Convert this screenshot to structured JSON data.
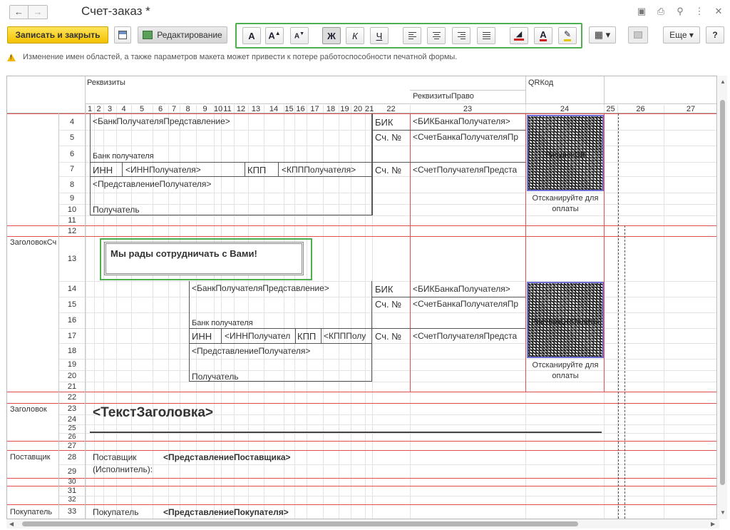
{
  "window": {
    "title": "Счет-заказ *"
  },
  "toolbar": {
    "save_close": "Записать и закрыть",
    "edit": "Редактирование",
    "more": "Еще ▾",
    "help": "?",
    "bold": "Ж",
    "italic": "К",
    "underline": "Ч"
  },
  "warning": {
    "text": "Изменение имен областей, а также параметров макета может привести к потере работоспособности печатной формы."
  },
  "sheet": {
    "col_headers": {
      "rekvizity": "Реквизиты",
      "rekvizity_pravo": "РеквизитыПраво",
      "qrkod": "QRКод"
    },
    "col_numbers": [
      "1",
      "2",
      "3",
      "4",
      "5",
      "6",
      "7",
      "8",
      "9",
      "10",
      "11",
      "12",
      "13",
      "14",
      "15",
      "16",
      "17",
      "18",
      "19",
      "20",
      "21",
      "22",
      "23",
      "24",
      "25",
      "26",
      "27"
    ],
    "row_numbers": [
      "4",
      "5",
      "6",
      "7",
      "8",
      "9",
      "10",
      "11",
      "12",
      "13",
      "14",
      "15",
      "16",
      "17",
      "18",
      "19",
      "20",
      "21",
      "22",
      "23",
      "24",
      "25",
      "26",
      "27",
      "28",
      "29",
      "30",
      "31",
      "32",
      "33"
    ],
    "area_labels": {
      "zagolovok_sch": "ЗаголовокСч",
      "zagolovok": "Заголовок",
      "postavshik": "Поставщик",
      "pokupatel": "Покупатель"
    },
    "bank_block": {
      "bank_pred": "<БанкПолучателяПредставление>",
      "bik": "БИК",
      "bik_param": "<БИКБанкаПолучателя>",
      "sch_no": "Сч. №",
      "sch_bank": "<СчетБанкаПолучателяПр",
      "bank_label": "Банк получателя",
      "inn": "ИНН",
      "inn_param": "<ИННПолучателя>",
      "inn_param_short": "<ИННПолучател",
      "kpp": "КПП",
      "kpp_param": "<КПППолучателя>",
      "kpp_param_short": "<КПППолу",
      "sch_pol": "<СчетПолучателяПредста",
      "pred_pol": "<ПредставлениеПолучателя>",
      "poluchatel": "Получатель"
    },
    "qr": {
      "image_label_1": "РисунокQR",
      "image_label_2": "РисунокQRОплаты",
      "scan_text_1": "Отсканируйте для",
      "scan_text_2": "оплаты"
    },
    "greeting": "Мы рады сотрудничать с Вами!",
    "title_param": "<ТекстЗаголовка>",
    "postavshik_label_1": "Поставщик",
    "postavshik_label_2": "(Исполнитель):",
    "postavshik_param": "<ПредставлениеПоставщика>",
    "pokupatel_label": "Покупатель",
    "pokupatel_param": "<ПредставлениеПокупателя>"
  },
  "colors": {
    "accent_green": "#4caf50",
    "save_button": "#f3c200",
    "area_boundary": "#e05050",
    "qr_selection": "#6f6fd8"
  }
}
